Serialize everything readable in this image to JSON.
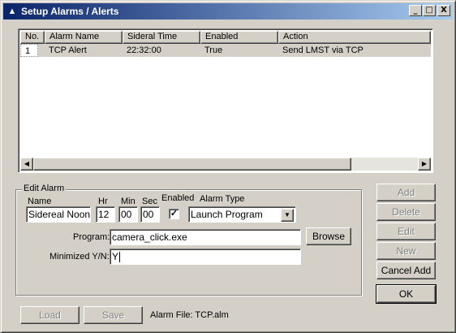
{
  "window": {
    "title": "Setup Alarms / Alerts",
    "controls": {
      "minimize": "_",
      "maximize": "□",
      "close": "X"
    }
  },
  "list": {
    "columns": [
      "No.",
      "Alarm Name",
      "Sideral Time",
      "Enabled",
      "Action"
    ],
    "rows": [
      {
        "no": "1",
        "name": "TCP Alert",
        "time": "22:32:00",
        "enabled": "True",
        "action": "Send LMST via TCP"
      }
    ],
    "scroll_left": "◀",
    "scroll_right": "▶"
  },
  "edit": {
    "group_title": "Edit Alarm",
    "name_label": "Name",
    "name_value": "Sidereal Noon",
    "hr_label": "Hr",
    "hr_value": "12",
    "min_label": "Min",
    "min_value": "00",
    "sec_label": "Sec",
    "sec_value": "00",
    "enabled_label": "Enabled",
    "enabled_check": "✓",
    "type_label": "Alarm Type",
    "type_value": "Launch Program",
    "type_arrow": "▼",
    "program_label": "Program:",
    "program_value": "camera_click.exe",
    "browse": "Browse",
    "minimized_label": "Minimized Y/N:",
    "minimized_value": "Y"
  },
  "side_buttons": {
    "add": "Add",
    "delete": "Delete",
    "edit": "Edit",
    "new": "New",
    "cancel_add": "Cancel Add",
    "ok": "OK"
  },
  "bottom": {
    "load": "Load",
    "save": "Save",
    "alarm_file": "Alarm File: TCP.alm"
  }
}
